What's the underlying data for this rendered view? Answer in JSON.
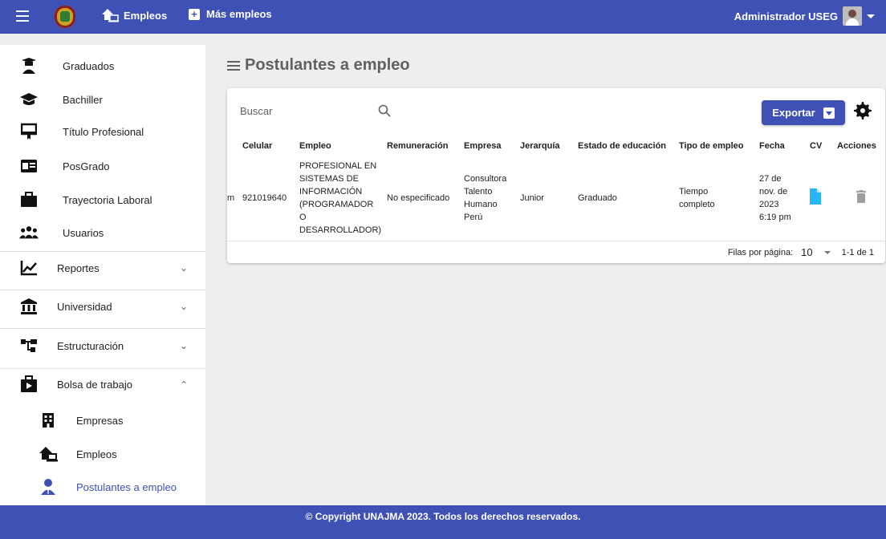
{
  "topbar": {
    "empleos_label": "Empleos",
    "mas_empleos_label": "Más empleos",
    "user_label": "Administrador USEG",
    "color": "#3f51b5"
  },
  "sidebar": {
    "items": [
      {
        "label": "Graduados",
        "icon": "graduate-icon"
      },
      {
        "label": "Bachiller",
        "icon": "mortarboard-icon"
      },
      {
        "label": "Título Profesional",
        "icon": "certificate-icon"
      },
      {
        "label": "PosGrado",
        "icon": "id-card-icon"
      },
      {
        "label": "Trayectoria Laboral",
        "icon": "briefcase-icon"
      },
      {
        "label": "Usuarios",
        "icon": "users-icon"
      },
      {
        "label": "Reportes",
        "icon": "chart-line-icon"
      },
      {
        "label": "Universidad",
        "icon": "university-icon"
      },
      {
        "label": "Estructuración",
        "icon": "hierarchy-icon"
      },
      {
        "label": "Bolsa de trabajo",
        "icon": "job-board-icon"
      },
      {
        "label": "Empresas",
        "icon": "building-icon"
      },
      {
        "label": "Empleos",
        "icon": "home-laptop-icon"
      },
      {
        "label": "Postulantes a empleo",
        "icon": "applicant-icon"
      }
    ]
  },
  "main": {
    "title": "Postulantes a empleo",
    "search_placeholder": "Buscar",
    "export_label": "Exportar",
    "table": {
      "headers": [
        "",
        "Celular",
        "Empleo",
        "Remuneración",
        "Empresa",
        "Jerarquía",
        "Estado de educación",
        "Tipo de empleo",
        "Fecha",
        "CV",
        "Acciones"
      ],
      "rows": [
        {
          "cut": "m",
          "celular": "921019640",
          "empleo": [
            "PROFESIONAL EN",
            "SISTEMAS DE",
            "INFORMACIÓN",
            "(PROGRAMADOR",
            "O",
            "DESARROLLADOR)"
          ],
          "remuneracion": "No especificado",
          "empresa": [
            "Consultora",
            "Talento",
            "Humano",
            "Perú"
          ],
          "jerarquia": "Junior",
          "estado": "Graduado",
          "tipo": [
            "Tiempo",
            "completo"
          ],
          "fecha": [
            "27 de",
            "nov. de",
            "2023",
            "6:19 pm"
          ]
        }
      ]
    },
    "pagination": {
      "rows_per_page_label": "Filas por página:",
      "rows_per_page": "10",
      "range": "1-1 de 1"
    }
  },
  "footer": {
    "text": "© Copyright UNAJMA 2023. Todos los derechos reservados."
  }
}
